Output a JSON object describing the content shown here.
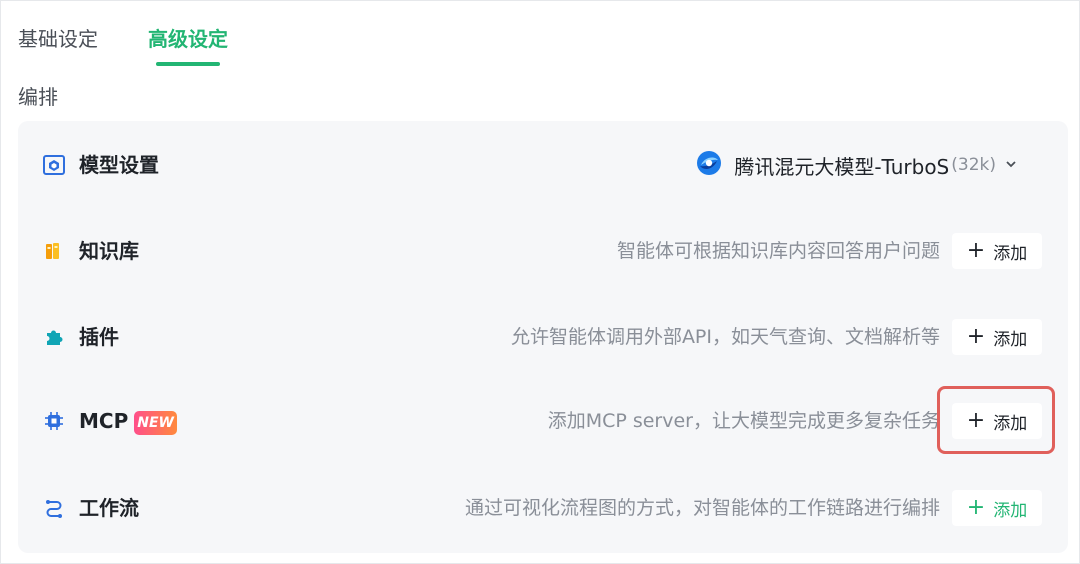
{
  "tabs": [
    {
      "label": "基础设定",
      "active": false
    },
    {
      "label": "高级设定",
      "active": true
    }
  ],
  "section_label": "编排",
  "model": {
    "title": "模型设置",
    "name": "腾讯混元大模型-TurboS",
    "context": "(32k)",
    "icon": "model-settings-icon"
  },
  "rows": [
    {
      "title": "知识库",
      "desc": "智能体可根据知识库内容回答用户问题",
      "button": "添加",
      "icon": "knowledge-base-icon"
    },
    {
      "title": "插件",
      "desc": "允许智能体调用外部API，如天气查询、文档解析等",
      "button": "添加",
      "icon": "plugin-puzzle-icon"
    },
    {
      "title": "MCP",
      "badge": "NEW",
      "desc": "添加MCP server，让大模型完成更多复杂任务",
      "button": "添加",
      "icon": "mcp-chip-icon"
    },
    {
      "title": "工作流",
      "desc": "通过可视化流程图的方式，对智能体的工作链路进行编排",
      "button": "添加",
      "icon": "workflow-icon"
    }
  ],
  "colors": {
    "accent": "#22b573",
    "highlight": "#e0605b",
    "card_bg": "#f6f7f9"
  }
}
